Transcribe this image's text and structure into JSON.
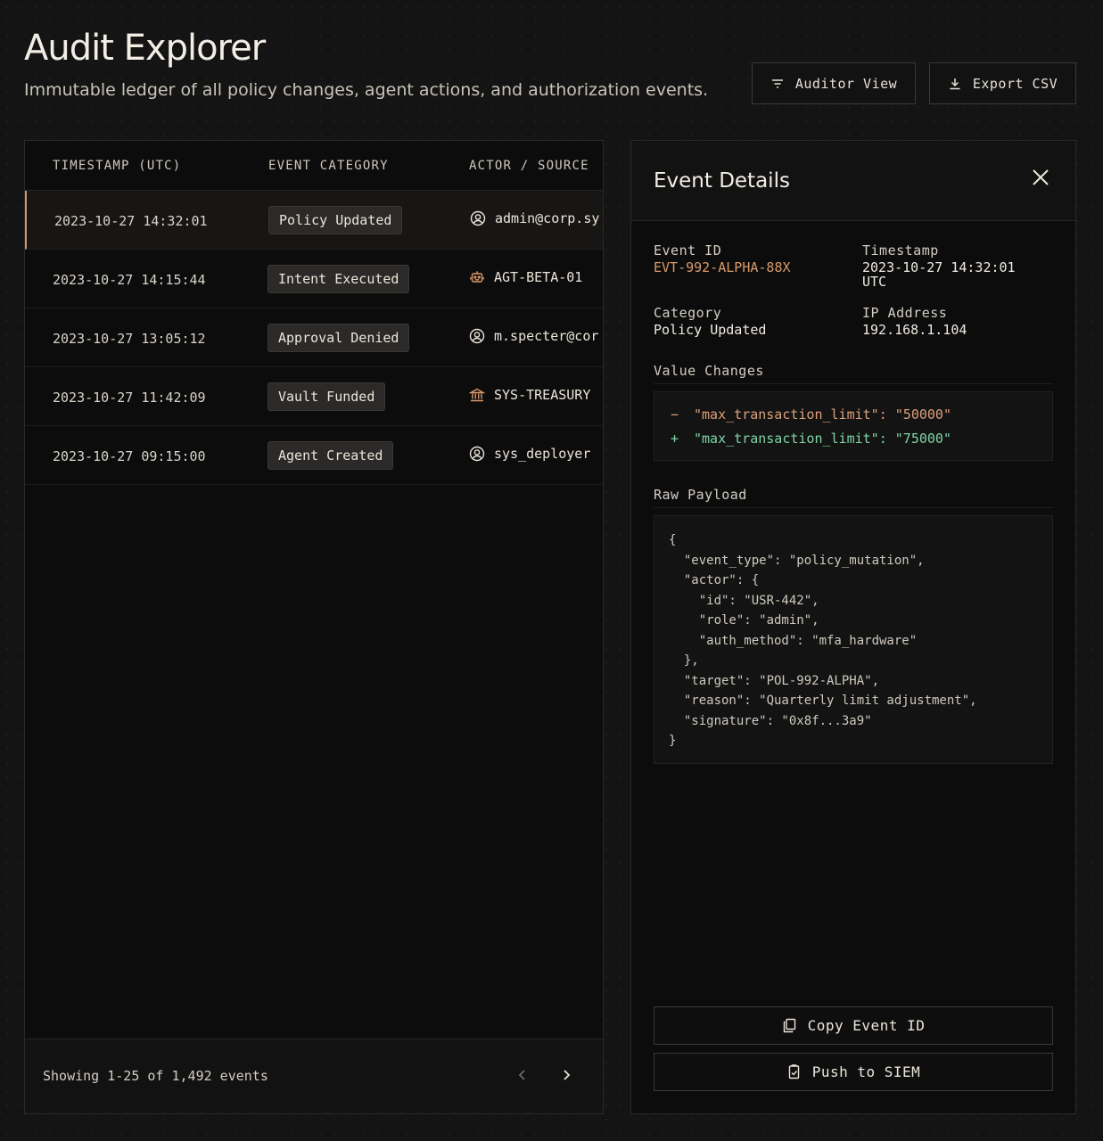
{
  "header": {
    "title": "Audit Explorer",
    "subtitle": "Immutable ledger of all policy changes, agent actions, and authorization events.",
    "auditor_label": "Auditor View",
    "export_label": "Export CSV"
  },
  "table": {
    "columns": [
      "TIMESTAMP (UTC)",
      "EVENT CATEGORY",
      "ACTOR / SOURCE"
    ],
    "rows": [
      {
        "timestamp": "2023-10-27 14:32:01",
        "category": "Policy Updated",
        "actor": "admin@corp.sy",
        "actor_icon": "user-circle-icon"
      },
      {
        "timestamp": "2023-10-27 14:15:44",
        "category": "Intent Executed",
        "actor": "AGT-BETA-01",
        "actor_icon": "robot-icon"
      },
      {
        "timestamp": "2023-10-27 13:05:12",
        "category": "Approval Denied",
        "actor": "m.specter@cor",
        "actor_icon": "user-circle-icon"
      },
      {
        "timestamp": "2023-10-27 11:42:09",
        "category": "Vault Funded",
        "actor": "SYS-TREASURY",
        "actor_icon": "bank-icon"
      },
      {
        "timestamp": "2023-10-27 09:15:00",
        "category": "Agent Created",
        "actor": "sys_deployer",
        "actor_icon": "user-circle-icon"
      }
    ],
    "footer_text": "Showing 1-25 of 1,492 events"
  },
  "details": {
    "title": "Event Details",
    "event_id_label": "Event ID",
    "event_id": "EVT-992-ALPHA-88X",
    "timestamp_label": "Timestamp",
    "timestamp_line1": "2023-10-27 14:32:01",
    "timestamp_line2": "UTC",
    "category_label": "Category",
    "category": "Policy Updated",
    "ip_label": "IP Address",
    "ip": "192.168.1.104",
    "value_changes_label": "Value Changes",
    "diff_minus_sign": "−",
    "diff_minus": "\"max_transaction_limit\": \"50000\"",
    "diff_plus_sign": "+",
    "diff_plus": "\"max_transaction_limit\": \"75000\"",
    "raw_payload_label": "Raw Payload",
    "payload_lines": [
      "{",
      "  \"event_type\": \"policy_mutation\",",
      "  \"actor\": {",
      "    \"id\": \"USR-442\",",
      "    \"role\": \"admin\",",
      "    \"auth_method\": \"mfa_hardware\"",
      "  },",
      "  \"target\": \"POL-992-ALPHA\",",
      "  \"reason\": \"Quarterly limit adjustment\",",
      "  \"signature\": \"0x8f...3a9\"",
      "}"
    ],
    "copy_label": "Copy Event ID",
    "push_label": "Push to SIEM"
  },
  "colors": {
    "accent": "#d79669",
    "diff_minus": "#dba07a",
    "diff_plus": "#7fd4a8"
  }
}
